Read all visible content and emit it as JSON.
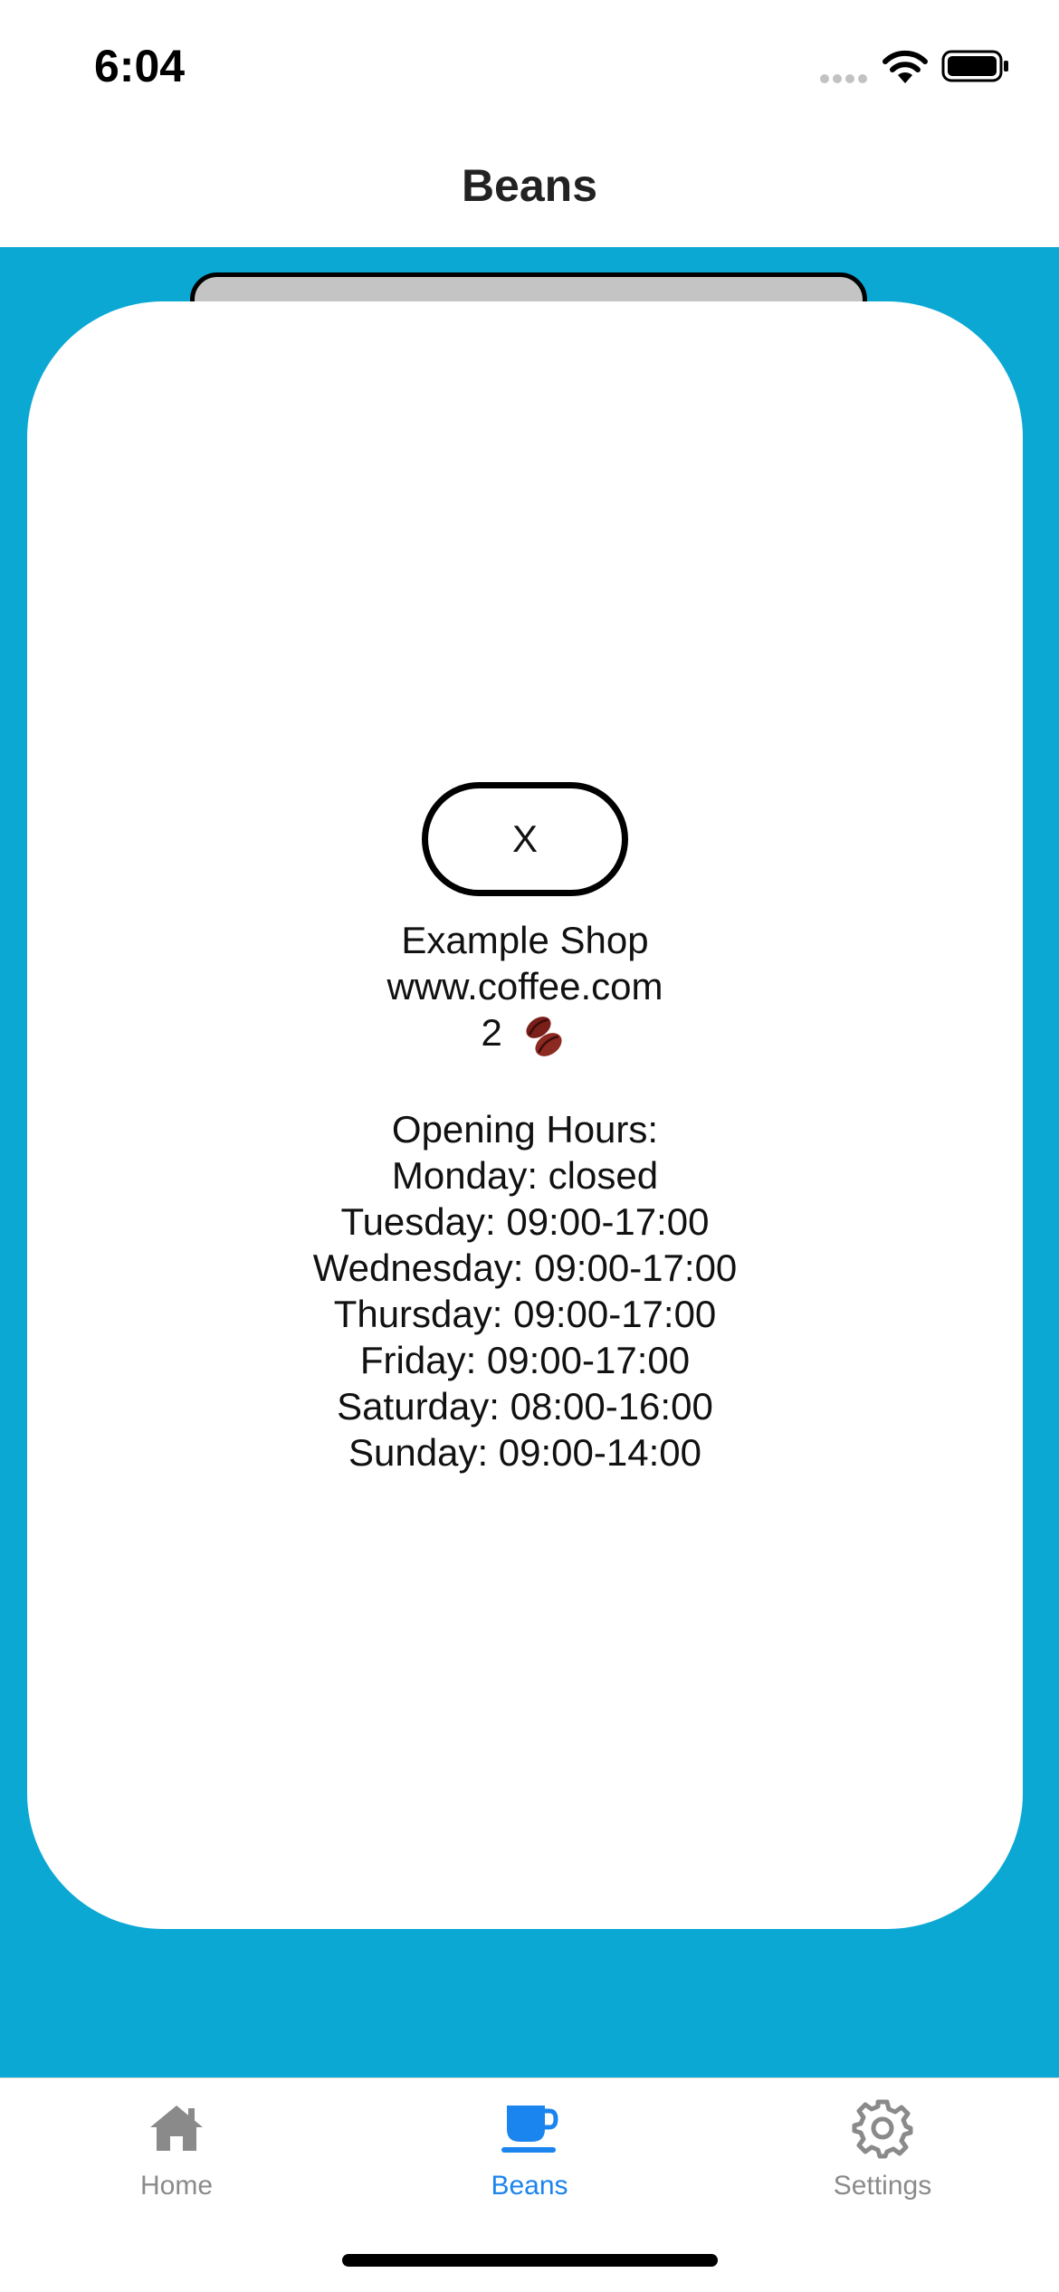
{
  "status_bar": {
    "time": "6:04",
    "icons": [
      "cellular-signal-icon",
      "wifi-icon",
      "battery-icon"
    ]
  },
  "nav": {
    "title": "Beans"
  },
  "detail": {
    "close_label": "X",
    "shop_name": "Example Shop",
    "website": "www.coffee.com",
    "rating_value": "2",
    "rating_icon": "coffee-beans-icon",
    "hours_title": "Opening Hours:",
    "hours": [
      "Monday: closed",
      "Tuesday: 09:00-17:00",
      "Wednesday: 09:00-17:00",
      "Thursday: 09:00-17:00",
      "Friday: 09:00-17:00",
      "Saturday: 08:00-16:00",
      "Sunday: 09:00-14:00"
    ]
  },
  "tabs": [
    {
      "label": "Home",
      "icon": "house-icon",
      "active": false
    },
    {
      "label": "Beans",
      "icon": "coffee-cup-icon",
      "active": true
    },
    {
      "label": "Settings",
      "icon": "gear-icon",
      "active": false
    }
  ],
  "colors": {
    "content_background": "#0ba8d4",
    "accent": "#1a84ef",
    "inactive_tab": "#8a8a8a",
    "card": "#ffffff",
    "sheet_back": "#c4c4c4"
  }
}
